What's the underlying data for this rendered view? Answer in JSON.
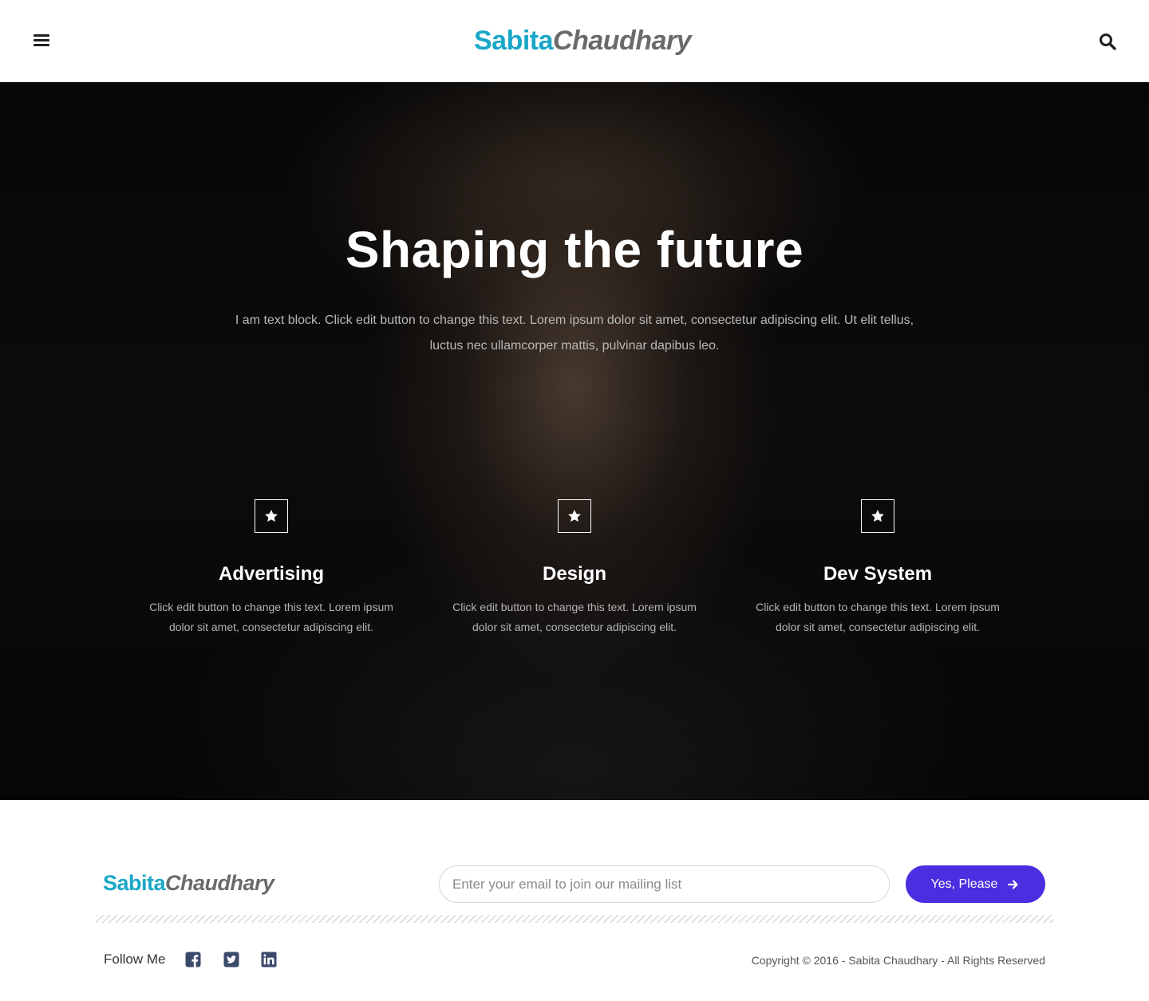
{
  "header": {
    "logo_first": "Sabita",
    "logo_second": "Chaudhary",
    "menu_icon": "hamburger-menu-icon",
    "search_icon": "search-icon"
  },
  "hero": {
    "title": "Shaping the future",
    "text": "I am text block. Click edit button to change this text. Lorem ipsum dolor sit amet, consectetur adipiscing elit. Ut elit tellus, luctus nec ullamcorper mattis, pulvinar dapibus leo.",
    "features": [
      {
        "icon": "star-icon",
        "title": "Advertising",
        "text": "Click edit button to change this text. Lorem ipsum dolor sit amet, consectetur adipiscing elit."
      },
      {
        "icon": "star-icon",
        "title": "Design",
        "text": "Click edit button to change this text. Lorem ipsum dolor sit amet, consectetur adipiscing elit."
      },
      {
        "icon": "star-icon",
        "title": "Dev System",
        "text": "Click edit button to change this text. Lorem ipsum dolor sit amet, consectetur adipiscing elit."
      }
    ]
  },
  "footer": {
    "logo_first": "Sabita",
    "logo_second": "Chaudhary",
    "email_placeholder": "Enter your email to join our mailing list",
    "submit_label": "Yes, Please",
    "follow_label": "Follow Me",
    "social": [
      "facebook-icon",
      "twitter-icon",
      "linkedin-icon"
    ],
    "copyright": "Copyright © 2016 - Sabita Chaudhary - All Rights Reserved"
  },
  "colors": {
    "logo_accent": "#1aa7c7",
    "logo_secondary": "#6a6a6a",
    "button": "#4a2fe0",
    "social_icons": "#3b4a6b"
  }
}
